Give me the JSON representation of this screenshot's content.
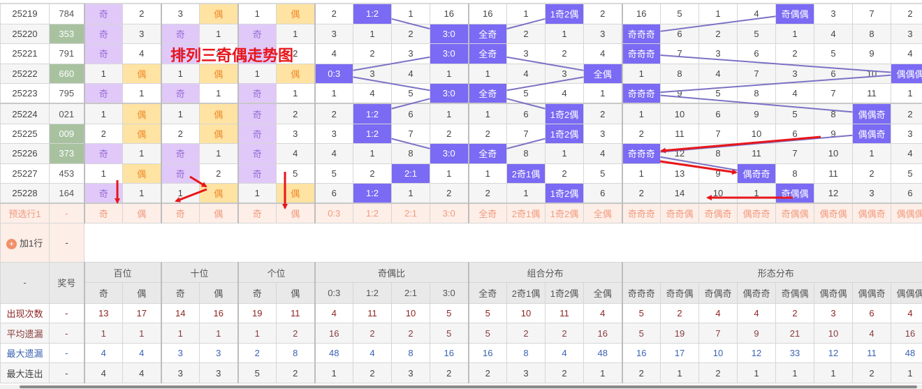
{
  "title": "排列三奇偶走势图",
  "colors": {
    "odd_bg": "#e0c9f9",
    "even_bg": "#fee3a2",
    "hit_bg": "#7a6af4",
    "line": "#7b72c4",
    "arrow": "#e8161b",
    "repeat_bg": "#a8c2a0"
  },
  "rows": [
    {
      "issue": "25219",
      "number": "784",
      "repeat": false,
      "cells": [
        "奇",
        "2",
        "3",
        "偶",
        "1",
        "偶",
        "2",
        "1:2",
        "1",
        "16",
        "16",
        "1",
        "1奇2偶",
        "2",
        "16",
        "5",
        "1",
        "4",
        "奇偶偶",
        "3",
        "7",
        "2"
      ]
    },
    {
      "issue": "25220",
      "number": "353",
      "repeat": true,
      "cells": [
        "奇",
        "3",
        "奇",
        "1",
        "奇",
        "1",
        "3",
        "1",
        "2",
        "3:0",
        "全奇",
        "2",
        "1",
        "3",
        "奇奇奇",
        "6",
        "2",
        "5",
        "1",
        "4",
        "8",
        "3"
      ]
    },
    {
      "issue": "25221",
      "number": "791",
      "repeat": false,
      "cells": [
        "奇",
        "4",
        "奇",
        "2",
        "奇",
        "2",
        "4",
        "2",
        "3",
        "3:0",
        "全奇",
        "3",
        "2",
        "4",
        "奇奇奇",
        "7",
        "3",
        "6",
        "2",
        "5",
        "9",
        "4"
      ]
    },
    {
      "issue": "25222",
      "number": "660",
      "repeat": true,
      "cells": [
        "1",
        "偶",
        "1",
        "偶",
        "1",
        "偶",
        "0:3",
        "3",
        "4",
        "1",
        "1",
        "4",
        "3",
        "全偶",
        "1",
        "8",
        "4",
        "7",
        "3",
        "6",
        "10",
        "偶偶偶"
      ]
    },
    {
      "issue": "25223",
      "number": "795",
      "repeat": false,
      "cells": [
        "奇",
        "1",
        "奇",
        "1",
        "奇",
        "1",
        "1",
        "4",
        "5",
        "3:0",
        "全奇",
        "5",
        "4",
        "1",
        "奇奇奇",
        "9",
        "5",
        "8",
        "4",
        "7",
        "11",
        "1"
      ]
    },
    {
      "issue": "25224",
      "number": "021",
      "repeat": false,
      "cells": [
        "1",
        "偶",
        "1",
        "偶",
        "奇",
        "2",
        "2",
        "1:2",
        "6",
        "1",
        "1",
        "6",
        "1奇2偶",
        "2",
        "1",
        "10",
        "6",
        "9",
        "5",
        "8",
        "偶偶奇",
        "2"
      ]
    },
    {
      "issue": "25225",
      "number": "009",
      "repeat": true,
      "cells": [
        "2",
        "偶",
        "2",
        "偶",
        "奇",
        "3",
        "3",
        "1:2",
        "7",
        "2",
        "2",
        "7",
        "1奇2偶",
        "3",
        "2",
        "11",
        "7",
        "10",
        "6",
        "9",
        "偶偶奇",
        "3"
      ]
    },
    {
      "issue": "25226",
      "number": "373",
      "repeat": true,
      "cells": [
        "奇",
        "1",
        "奇",
        "1",
        "奇",
        "4",
        "4",
        "1",
        "8",
        "3:0",
        "全奇",
        "8",
        "1",
        "4",
        "奇奇奇",
        "12",
        "8",
        "11",
        "7",
        "10",
        "1",
        "4"
      ]
    },
    {
      "issue": "25227",
      "number": "453",
      "repeat": false,
      "cells": [
        "1",
        "偶",
        "奇",
        "2",
        "奇",
        "5",
        "5",
        "2",
        "2:1",
        "1",
        "1",
        "2奇1偶",
        "2",
        "5",
        "1",
        "13",
        "9",
        "偶奇奇",
        "8",
        "11",
        "2",
        "5"
      ]
    },
    {
      "issue": "25228",
      "number": "164",
      "repeat": false,
      "cells": [
        "奇",
        "1",
        "1",
        "偶",
        "1",
        "偶",
        "6",
        "1:2",
        "1",
        "2",
        "2",
        "1",
        "1奇2偶",
        "6",
        "2",
        "14",
        "10",
        "1",
        "奇偶偶",
        "12",
        "3",
        "6"
      ]
    }
  ],
  "preselect": {
    "label": "预选行1",
    "number": "-",
    "cells": [
      "奇",
      "偶",
      "奇",
      "偶",
      "奇",
      "偶",
      "0:3",
      "1:2",
      "2:1",
      "3:0",
      "全奇",
      "2奇1偶",
      "1奇2偶",
      "全偶",
      "奇奇奇",
      "奇奇偶",
      "奇偶奇",
      "偶奇奇",
      "奇偶偶",
      "偶奇偶",
      "偶偶奇",
      "偶偶偶"
    ]
  },
  "add_row": {
    "label": "加1行",
    "icon": "plus-circle-icon",
    "number": "-"
  },
  "header": {
    "corner": "-",
    "number": "奖号",
    "groups": [
      {
        "label": "百位",
        "cols": [
          "奇",
          "偶"
        ]
      },
      {
        "label": "十位",
        "cols": [
          "奇",
          "偶"
        ]
      },
      {
        "label": "个位",
        "cols": [
          "奇",
          "偶"
        ]
      },
      {
        "label": "奇偶比",
        "cols": [
          "0:3",
          "1:2",
          "2:1",
          "3:0"
        ]
      },
      {
        "label": "组合分布",
        "cols": [
          "全奇",
          "2奇1偶",
          "1奇2偶",
          "全偶"
        ]
      },
      {
        "label": "形态分布",
        "cols": [
          "奇奇奇",
          "奇奇偶",
          "奇偶奇",
          "偶奇奇",
          "奇偶偶",
          "偶奇偶",
          "偶偶奇",
          "偶偶偶"
        ]
      }
    ]
  },
  "stats": [
    {
      "label": "出现次数",
      "cls": "c-occ",
      "number": "-",
      "values": [
        "13",
        "17",
        "14",
        "16",
        "19",
        "11",
        "4",
        "11",
        "10",
        "5",
        "5",
        "10",
        "11",
        "4",
        "5",
        "2",
        "4",
        "4",
        "2",
        "3",
        "6",
        "4"
      ]
    },
    {
      "label": "平均遗漏",
      "cls": "c-avg",
      "number": "-",
      "values": [
        "1",
        "1",
        "1",
        "1",
        "1",
        "2",
        "16",
        "2",
        "2",
        "5",
        "5",
        "2",
        "2",
        "16",
        "5",
        "19",
        "7",
        "9",
        "21",
        "10",
        "4",
        "16"
      ]
    },
    {
      "label": "最大遗漏",
      "cls": "c-max",
      "number": "-",
      "values": [
        "4",
        "4",
        "3",
        "3",
        "2",
        "8",
        "48",
        "4",
        "8",
        "16",
        "16",
        "8",
        "4",
        "48",
        "16",
        "17",
        "10",
        "12",
        "33",
        "12",
        "11",
        "48"
      ]
    },
    {
      "label": "最大连出",
      "cls": "c-run",
      "number": "-",
      "values": [
        "4",
        "4",
        "3",
        "3",
        "5",
        "2",
        "1",
        "2",
        "3",
        "2",
        "2",
        "3",
        "2",
        "1",
        "2",
        "1",
        "2",
        "1",
        "1",
        "1",
        "2",
        "1"
      ]
    }
  ]
}
